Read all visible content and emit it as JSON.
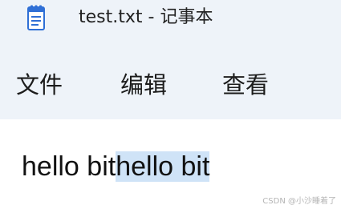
{
  "window": {
    "title": "test.txt - 记事本"
  },
  "menu": {
    "file": "文件",
    "edit": "编辑",
    "view": "查看"
  },
  "editor": {
    "text_unselected": "hello bit",
    "text_selected": "hello bit"
  },
  "watermark": "CSDN @小沙睡着了",
  "icons": {
    "app": "notepad-icon"
  },
  "colors": {
    "chrome_bg": "#eef3f9",
    "selection": "#cfe3f7",
    "notepad_icon_blue": "#2f6fd6"
  }
}
